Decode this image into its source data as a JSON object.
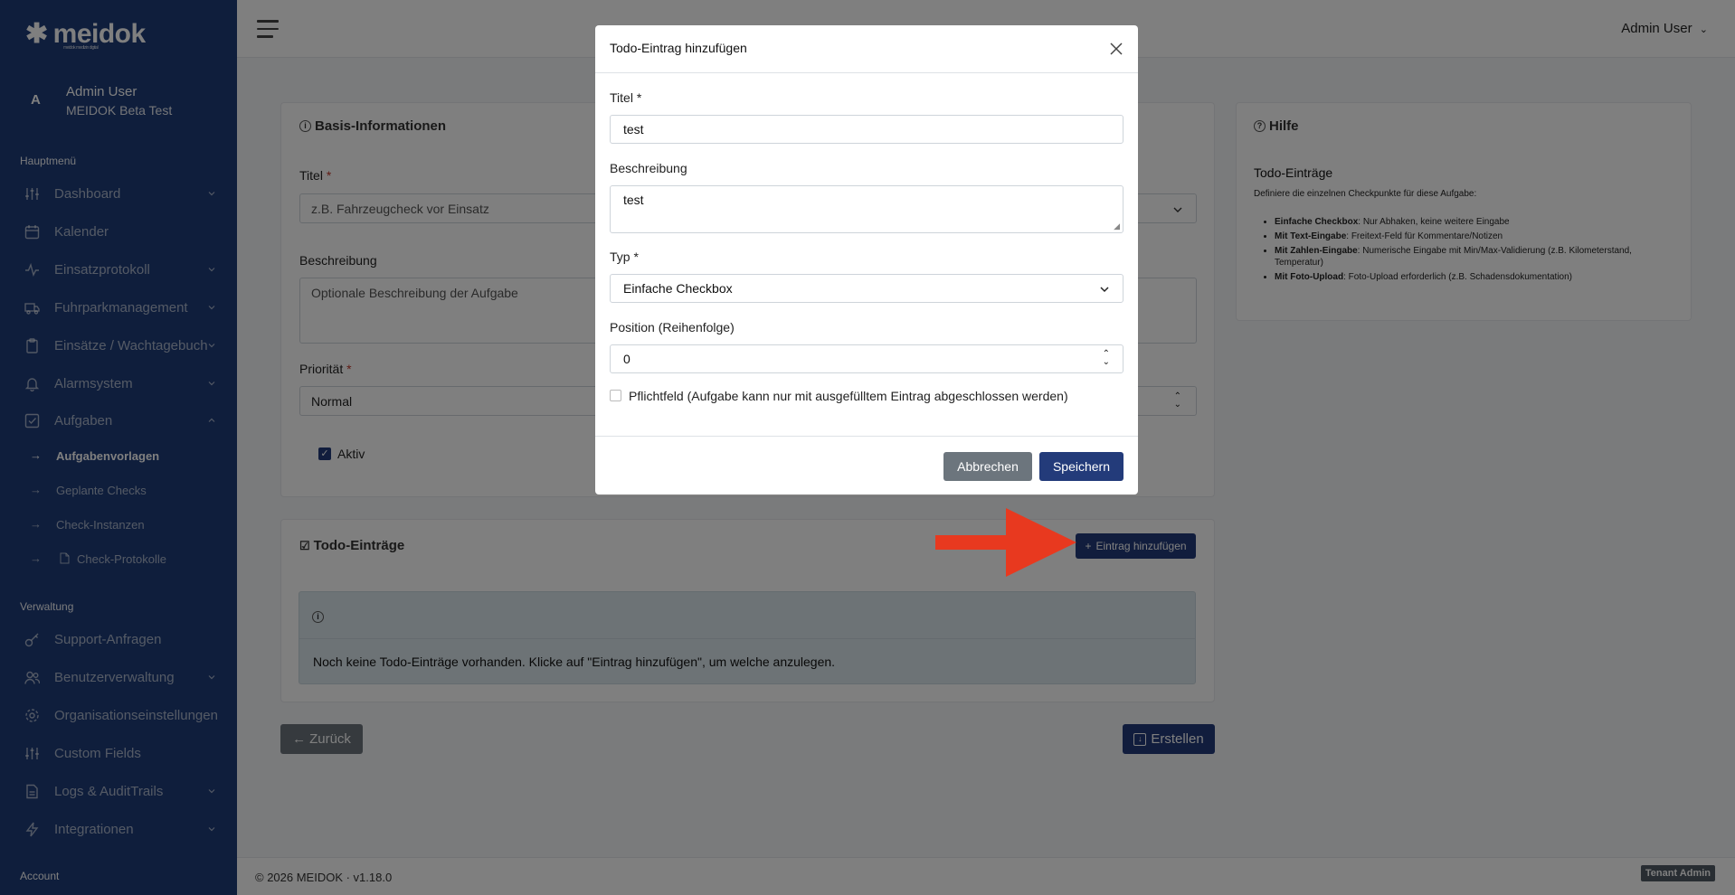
{
  "sidebar": {
    "logo": "meidok",
    "logo_tagline": "meidok medizin digital",
    "user": {
      "initial": "A",
      "name": "Admin User",
      "org": "MEIDOK Beta Test"
    },
    "section_main": "Hauptmenü",
    "section_admin": "Verwaltung",
    "account": "Account",
    "main_items": [
      {
        "label": "Dashboard"
      },
      {
        "label": "Kalender"
      },
      {
        "label": "Einsatzprotokoll"
      },
      {
        "label": "Fuhrparkmanagement"
      },
      {
        "label": "Einsätze / Wachtagebuch"
      },
      {
        "label": "Alarmsystem"
      },
      {
        "label": "Aufgaben"
      }
    ],
    "sub_items": [
      {
        "label": "Aufgabenvorlagen"
      },
      {
        "label": "Geplante Checks"
      },
      {
        "label": "Check-Instanzen"
      },
      {
        "label": "Check-Protokolle"
      }
    ],
    "admin_items": [
      {
        "label": "Support-Anfragen"
      },
      {
        "label": "Benutzerverwaltung"
      },
      {
        "label": "Organisationseinstellungen"
      },
      {
        "label": "Custom Fields"
      },
      {
        "label": "Logs & AuditTrails"
      },
      {
        "label": "Integrationen"
      }
    ]
  },
  "header": {
    "user_menu": "Admin User"
  },
  "basis": {
    "title": "Basis-Informationen",
    "titel_label": "Titel",
    "titel_placeholder": "z.B. Fahrzeugcheck vor Einsatz",
    "beschreibung_label": "Beschreibung",
    "beschreibung_placeholder": "Optionale Beschreibung der Aufgabe",
    "prioritaet_label": "Priorität",
    "prioritaet_value": "Normal",
    "aktiv_label": "Aktiv"
  },
  "help": {
    "title": "Hilfe",
    "heading": "Todo-Einträge",
    "intro": "Definiere die einzelnen Checkpunkte für diese Aufgabe:",
    "items": [
      {
        "term": "Einfache Checkbox",
        "desc": ": Nur Abhaken, keine weitere Eingabe"
      },
      {
        "term": "Mit Text-Eingabe",
        "desc": ": Freitext-Feld für Kommentare/Notizen"
      },
      {
        "term": "Mit Zahlen-Eingabe",
        "desc": ": Numerische Eingabe mit Min/Max-Validierung (z.B. Kilometerstand, Temperatur)"
      },
      {
        "term": "Mit Foto-Upload",
        "desc": ": Foto-Upload erforderlich (z.B. Schadensdokumentation)"
      }
    ]
  },
  "todos": {
    "title": "Todo-Einträge",
    "add_button": "Eintrag hinzufügen",
    "empty_text": "Noch keine Todo-Einträge vorhanden. Klicke auf \"Eintrag hinzufügen\", um welche anzulegen."
  },
  "actions": {
    "back": "Zurück",
    "create": "Erstellen"
  },
  "footer": {
    "copyright": "© 2026 MEIDOK · v1.18.0",
    "badge": "Tenant Admin"
  },
  "modal": {
    "title": "Todo-Eintrag hinzufügen",
    "titel_label": "Titel *",
    "titel_value": "test",
    "beschreibung_label": "Beschreibung",
    "beschreibung_value": "test",
    "typ_label": "Typ *",
    "typ_value": "Einfache Checkbox",
    "position_label": "Position (Reihenfolge)",
    "position_value": "0",
    "pflicht_label": "Pflichtfeld (Aufgabe kann nur mit ausgefülltem Eintrag abgeschlossen werden)",
    "cancel": "Abbrechen",
    "save": "Speichern"
  },
  "colors": {
    "sidebar": "#1e3c78",
    "primary": "#233b7a",
    "secondary": "#6c757d",
    "annotation_arrow": "#e8391f"
  }
}
